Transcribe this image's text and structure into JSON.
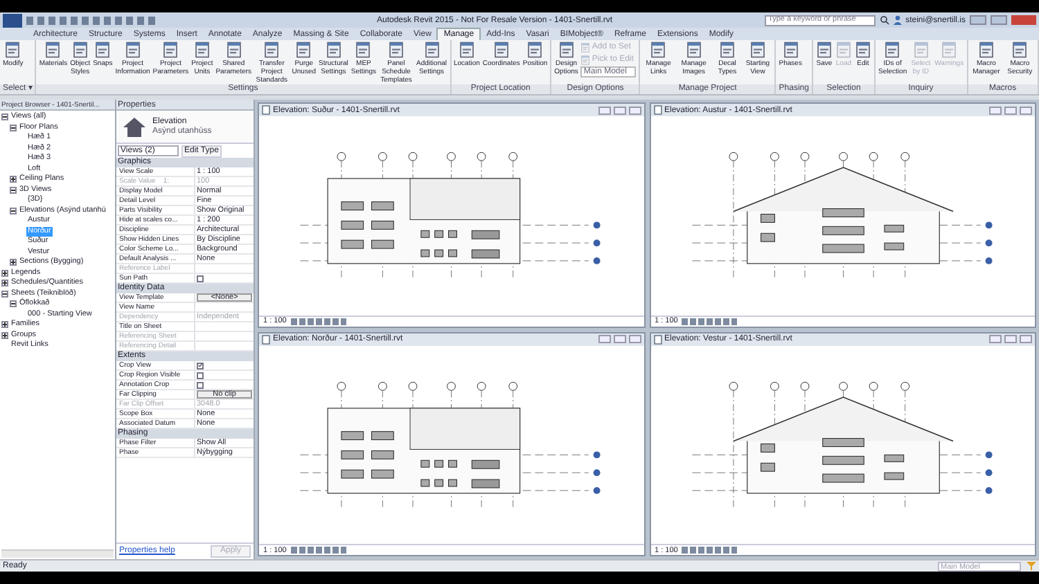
{
  "title_bar": {
    "title": "Autodesk Revit 2015 - Not For Resale Version - 1401-Snertill.rvt",
    "search_placeholder": "Type a keyword or phrase",
    "user": "steini@snertill.is"
  },
  "tabs": [
    {
      "label": "Architecture",
      "selected": false
    },
    {
      "label": "Structure",
      "selected": false
    },
    {
      "label": "Systems",
      "selected": false
    },
    {
      "label": "Insert",
      "selected": false
    },
    {
      "label": "Annotate",
      "selected": false
    },
    {
      "label": "Analyze",
      "selected": false
    },
    {
      "label": "Massing & Site",
      "selected": false
    },
    {
      "label": "Collaborate",
      "selected": false
    },
    {
      "label": "View",
      "selected": false
    },
    {
      "label": "Manage",
      "selected": true
    },
    {
      "label": "Add-Ins",
      "selected": false
    },
    {
      "label": "Vasari",
      "selected": false
    },
    {
      "label": "BIMobject®",
      "selected": false
    },
    {
      "label": "Reframe",
      "selected": false
    },
    {
      "label": "Extensions",
      "selected": false
    },
    {
      "label": "Modify",
      "selected": false
    }
  ],
  "ribbon": [
    {
      "label": "Select ▾",
      "tools": [
        {
          "kind": "large",
          "label": "Modify",
          "disabled": false
        }
      ]
    },
    {
      "label": "Settings",
      "tools": [
        {
          "kind": "large",
          "label": "Materials",
          "disabled": false
        },
        {
          "kind": "large",
          "label": "Object Styles",
          "disabled": false
        },
        {
          "kind": "large",
          "label": "Snaps",
          "disabled": false
        },
        {
          "kind": "large",
          "label": "Project Information",
          "disabled": false
        },
        {
          "kind": "large",
          "label": "Project Parameters",
          "disabled": false
        },
        {
          "kind": "large",
          "label": "Project Units",
          "disabled": false
        },
        {
          "kind": "large",
          "label": "Shared Parameters",
          "disabled": false
        },
        {
          "kind": "large",
          "label": "Transfer Project Standards",
          "disabled": false
        },
        {
          "kind": "large",
          "label": "Purge Unused",
          "disabled": false
        },
        {
          "kind": "large",
          "label": "Structural Settings",
          "disabled": false
        },
        {
          "kind": "large",
          "label": "MEP Settings",
          "disabled": false
        },
        {
          "kind": "large",
          "label": "Panel Schedule Templates",
          "disabled": false
        },
        {
          "kind": "large",
          "label": "Additional Settings",
          "disabled": false
        }
      ]
    },
    {
      "label": "Project Location",
      "tools": [
        {
          "kind": "large",
          "label": "Location",
          "disabled": false
        },
        {
          "kind": "large",
          "label": "Coordinates",
          "disabled": false
        },
        {
          "kind": "large",
          "label": "Position",
          "disabled": false
        }
      ]
    },
    {
      "label": "Design Options",
      "tools": [
        {
          "kind": "large",
          "label": "Design Options",
          "disabled": false
        },
        {
          "kind": "small",
          "label": "Add to Set",
          "disabled": true
        },
        {
          "kind": "small",
          "label": "Pick to Edit",
          "disabled": true
        },
        {
          "kind": "dropdown",
          "label": "Main Model",
          "disabled": false
        }
      ]
    },
    {
      "label": "Manage Project",
      "tools": [
        {
          "kind": "large",
          "label": "Manage Links",
          "disabled": false
        },
        {
          "kind": "large",
          "label": "Manage Images",
          "disabled": false
        },
        {
          "kind": "large",
          "label": "Decal Types",
          "disabled": false
        },
        {
          "kind": "large",
          "label": "Starting View",
          "disabled": false
        }
      ]
    },
    {
      "label": "Phasing",
      "tools": [
        {
          "kind": "large",
          "label": "Phases",
          "disabled": false
        }
      ]
    },
    {
      "label": "Selection",
      "tools": [
        {
          "kind": "large",
          "label": "Save",
          "disabled": false
        },
        {
          "kind": "large",
          "label": "Load",
          "disabled": true
        },
        {
          "kind": "large",
          "label": "Edit",
          "disabled": false
        }
      ]
    },
    {
      "label": "Inquiry",
      "tools": [
        {
          "kind": "large",
          "label": "IDs of Selection",
          "disabled": false
        },
        {
          "kind": "large",
          "label": "Select by ID",
          "disabled": true
        },
        {
          "kind": "large",
          "label": "Warnings",
          "disabled": true
        }
      ]
    },
    {
      "label": "Macros",
      "tools": [
        {
          "kind": "large",
          "label": "Macro Manager",
          "disabled": false
        },
        {
          "kind": "large",
          "label": "Macro Security",
          "disabled": false
        }
      ]
    }
  ],
  "project_browser": {
    "title": "Project Browser - 1401-Snertil...",
    "tree": [
      {
        "label": "Views (all)",
        "expanded": true,
        "selected": false,
        "children": [
          {
            "label": "Floor Plans",
            "expanded": true,
            "selected": false,
            "children": [
              {
                "label": "Hæð 1",
                "selected": false
              },
              {
                "label": "Hæð 2",
                "selected": false
              },
              {
                "label": "Hæð 3",
                "selected": false
              },
              {
                "label": "Loft",
                "selected": false
              }
            ]
          },
          {
            "label": "Ceiling Plans",
            "expanded": false,
            "selected": false
          },
          {
            "label": "3D Views",
            "expanded": true,
            "selected": false,
            "children": [
              {
                "label": "{3D}",
                "selected": false
              }
            ]
          },
          {
            "label": "Elevations (Asýnd utanhú",
            "expanded": true,
            "selected": false,
            "children": [
              {
                "label": "Austur",
                "selected": false
              },
              {
                "label": "Norður",
                "selected": true
              },
              {
                "label": "Suður",
                "selected": false
              },
              {
                "label": "Vestur",
                "selected": false
              }
            ]
          },
          {
            "label": "Sections (Bygging)",
            "expanded": false,
            "selected": false
          }
        ]
      },
      {
        "label": "Legends",
        "expanded": false,
        "selected": false
      },
      {
        "label": "Schedules/Quantities",
        "expanded": false,
        "selected": false
      },
      {
        "label": "Sheets (Teikniblöð)",
        "expanded": true,
        "selected": false,
        "children": [
          {
            "label": "Óflokkað",
            "expanded": true,
            "selected": false,
            "children": [
              {
                "label": "000 - Starting View",
                "selected": false
              }
            ]
          }
        ]
      },
      {
        "label": "Families",
        "expanded": false,
        "selected": false
      },
      {
        "label": "Groups",
        "expanded": false,
        "selected": false
      },
      {
        "label": "Revit Links",
        "selected": false
      }
    ]
  },
  "properties": {
    "title": "Properties",
    "type_name": "Elevation",
    "type_sub": "Asýnd utanhúss",
    "selector": "Views (2)",
    "edit_type": "Edit Type",
    "sections": [
      {
        "label": "Graphics",
        "rows": [
          {
            "kind": "text",
            "name": "View Scale",
            "value": "1 : 100",
            "disabled": false
          },
          {
            "kind": "text",
            "name": "Scale Value    1:",
            "value": "100",
            "disabled": true
          },
          {
            "kind": "text",
            "name": "Display Model",
            "value": "Normal",
            "disabled": false
          },
          {
            "kind": "text",
            "name": "Detail Level",
            "value": "Fine",
            "disabled": false
          },
          {
            "kind": "text",
            "name": "Parts Visibility",
            "value": "Show Original",
            "disabled": false
          },
          {
            "kind": "text",
            "name": "Hide at scales co...",
            "value": "1 : 200",
            "disabled": false
          },
          {
            "kind": "text",
            "name": "Discipline",
            "value": "Architectural",
            "disabled": false
          },
          {
            "kind": "text",
            "name": "Show Hidden Lines",
            "value": "By Discipline",
            "disabled": false
          },
          {
            "kind": "text",
            "name": "Color Scheme Lo...",
            "value": "Background",
            "disabled": false
          },
          {
            "kind": "text",
            "name": "Default Analysis ...",
            "value": "None",
            "disabled": false
          },
          {
            "kind": "text",
            "name": "Reference Label",
            "disabled": true
          },
          {
            "kind": "checkbox",
            "name": "Sun Path",
            "checked": false,
            "disabled": false
          }
        ]
      },
      {
        "label": "Identity Data",
        "rows": [
          {
            "kind": "button",
            "name": "View Template",
            "value": "<None>",
            "disabled": false
          },
          {
            "kind": "text",
            "name": "View Name",
            "disabled": false
          },
          {
            "kind": "text",
            "name": "Dependency",
            "value": "Independent",
            "disabled": true
          },
          {
            "kind": "text",
            "name": "Title on Sheet",
            "disabled": false
          },
          {
            "kind": "text",
            "name": "Referencing Sheet",
            "disabled": true
          },
          {
            "kind": "text",
            "name": "Referencing Detail",
            "disabled": true
          }
        ]
      },
      {
        "label": "Extents",
        "rows": [
          {
            "kind": "checkbox",
            "name": "Crop View",
            "checked": true,
            "disabled": false
          },
          {
            "kind": "checkbox",
            "name": "Crop Region Visible",
            "checked": false,
            "disabled": false
          },
          {
            "kind": "checkbox",
            "name": "Annotation Crop",
            "checked": false,
            "disabled": false
          },
          {
            "kind": "button",
            "name": "Far Clipping",
            "value": "No clip",
            "disabled": false
          },
          {
            "kind": "text",
            "name": "Far Clip Offset",
            "value": "3048.0",
            "disabled": true
          },
          {
            "kind": "text",
            "name": "Scope Box",
            "value": "None",
            "disabled": false
          },
          {
            "kind": "text",
            "name": "Associated Datum",
            "value": "None",
            "disabled": false
          }
        ]
      },
      {
        "label": "Phasing",
        "rows": [
          {
            "kind": "text",
            "name": "Phase Filter",
            "value": "Show All",
            "disabled": false
          },
          {
            "kind": "text",
            "name": "Phase",
            "value": "Nýbygging",
            "disabled": false
          }
        ]
      }
    ],
    "help": "Properties help",
    "apply": "Apply"
  },
  "views": [
    {
      "title": "Elevation: Suður - 1401-Snertill.rvt",
      "scale": "1 : 100"
    },
    {
      "title": "Elevation: Austur - 1401-Snertill.rvt",
      "scale": "1 : 100"
    },
    {
      "title": "Elevation: Norður - 1401-Snertill.rvt",
      "scale": "1 : 100"
    },
    {
      "title": "Elevation: Vestur - 1401-Snertill.rvt",
      "scale": "1 : 100"
    }
  ],
  "status_bar": {
    "text": "Ready",
    "model": "Main Model"
  }
}
